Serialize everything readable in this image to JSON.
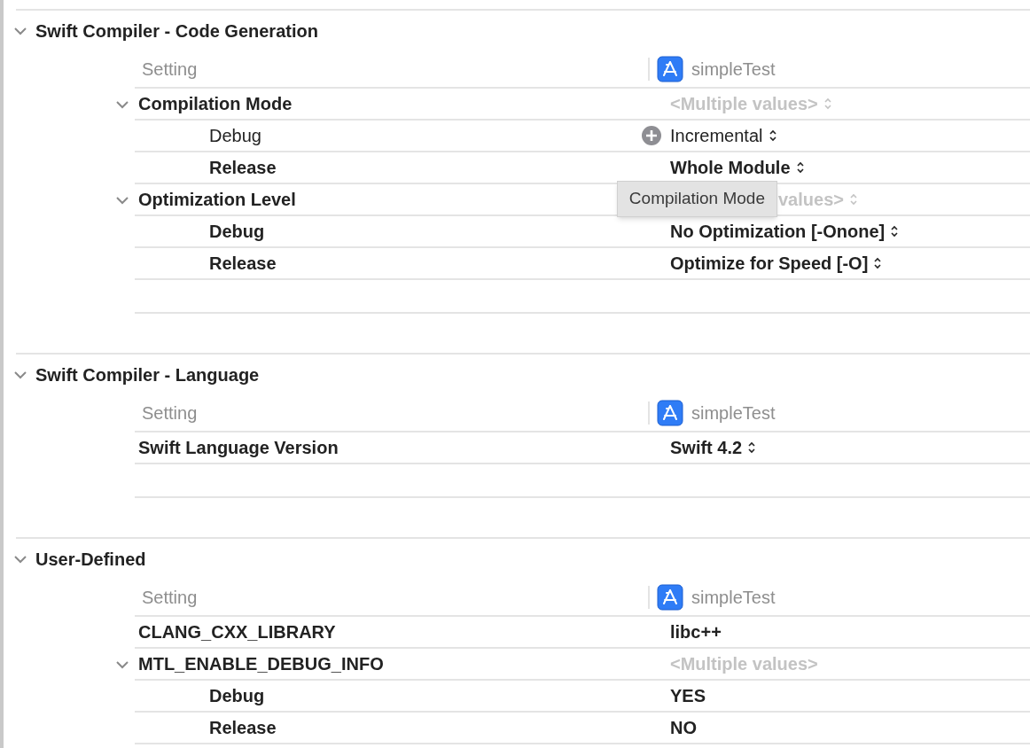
{
  "sections": [
    {
      "title": "Swift Compiler - Code Generation",
      "expanded": true,
      "header": {
        "setting": "Setting",
        "target": "simpleTest"
      },
      "rows": [
        {
          "name": "Compilation Mode",
          "expanded": true,
          "kind": "multiple",
          "value": "<Multiple values>",
          "popup": true,
          "customized": true,
          "children": [
            {
              "name": "Debug",
              "kind": "value",
              "value": "Incremental",
              "popup": true,
              "customized": false,
              "add_button": true
            },
            {
              "name": "Release",
              "kind": "value",
              "value": "Whole Module",
              "popup": true,
              "customized": true
            }
          ]
        },
        {
          "name": "Optimization Level",
          "expanded": true,
          "kind": "multiple",
          "value": "values>",
          "popup": true,
          "customized": true,
          "tooltip": "Compilation Mode",
          "children": [
            {
              "name": "Debug",
              "kind": "value",
              "value": "No Optimization [-Onone]",
              "popup": true,
              "customized": true
            },
            {
              "name": "Release",
              "kind": "value",
              "value": "Optimize for Speed [-O]",
              "popup": true,
              "customized": true
            }
          ]
        }
      ]
    },
    {
      "title": "Swift Compiler - Language",
      "expanded": true,
      "header": {
        "setting": "Setting",
        "target": "simpleTest"
      },
      "rows": [
        {
          "name": "Swift Language Version",
          "kind": "value",
          "value": "Swift 4.2",
          "popup": true,
          "customized": true
        }
      ]
    },
    {
      "title": "User-Defined",
      "expanded": true,
      "header": {
        "setting": "Setting",
        "target": "simpleTest"
      },
      "rows": [
        {
          "name": "CLANG_CXX_LIBRARY",
          "kind": "value",
          "value": "libc++",
          "popup": false,
          "customized": true
        },
        {
          "name": "MTL_ENABLE_DEBUG_INFO",
          "expanded": true,
          "kind": "multiple",
          "value": "<Multiple values>",
          "popup": false,
          "customized": true,
          "children": [
            {
              "name": "Debug",
              "kind": "value",
              "value": "YES",
              "popup": false,
              "customized": true
            },
            {
              "name": "Release",
              "kind": "value",
              "value": "NO",
              "popup": false,
              "customized": true
            }
          ]
        }
      ]
    }
  ]
}
